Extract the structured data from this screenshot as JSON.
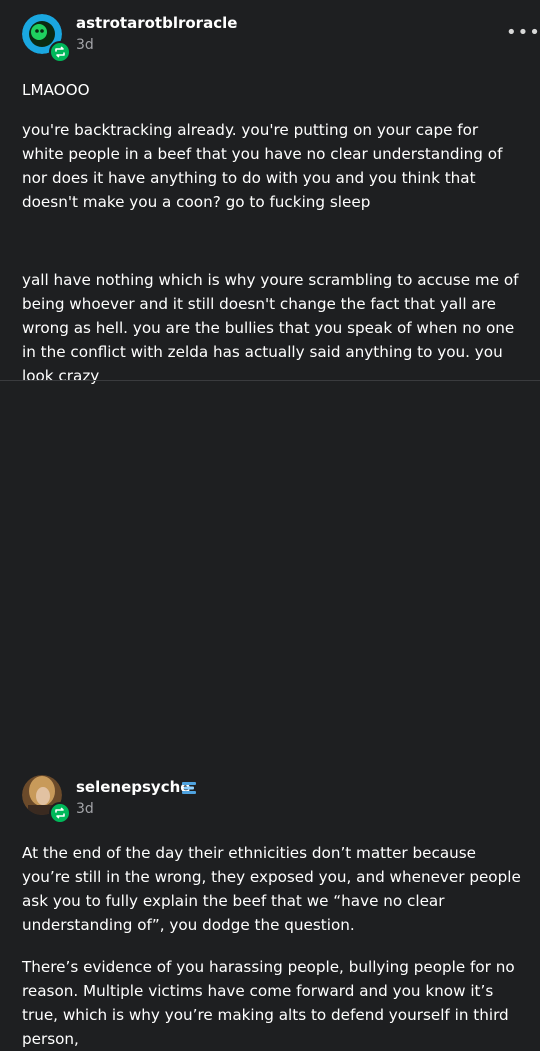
{
  "post1": {
    "username": "astrotarotblroracle",
    "time": "3d",
    "more_label": "•••",
    "paragraphs": [
      "LMAOOO",
      "you're backtracking already. you're putting on your cape for white people in a beef that you have no clear understanding of nor does it have anything to do with you and you think that doesn't make you a coon? go to fucking sleep",
      "yall have nothing which is why youre scrambling to accuse me of being whoever and it still doesn't change the fact that yall are wrong as hell. you are the bullies that you speak of when no one in the conflict with zelda has actually said anything to you. you look crazy"
    ]
  },
  "post2": {
    "username": "selenepsyche",
    "time": "3d",
    "paragraphs": [
      "At the end of the day their ethnicities don’t matter because you’re still in the wrong, they exposed you, and whenever people ask you to fully explain the beef that we “have no clear understanding of”, you dodge the question.",
      "There’s evidence of you harassing people, bullying people for no reason. Multiple victims have come forward and you know it’s true, which is why you’re making alts to defend yourself in third person,"
    ]
  },
  "colors": {
    "background": "#1e1f21",
    "reblog_badge": "#00b85a",
    "avatar1": "#1aa7e0",
    "muted_text": "#a3a4a8"
  }
}
